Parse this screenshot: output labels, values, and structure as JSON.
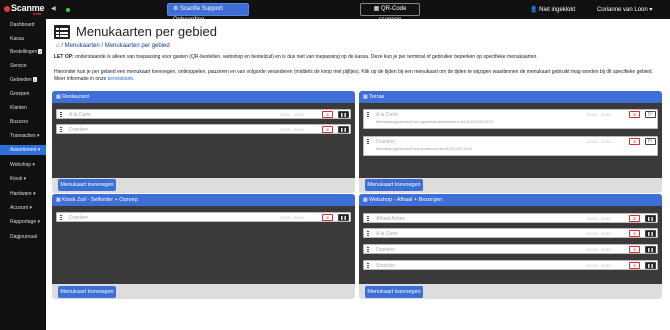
{
  "topbar": {
    "brand": "Scanme",
    "beta": "beta",
    "support_button": "Scanfie Support Onboarding",
    "qr_button": "QR-Code scannen",
    "login_status": "Niet ingeklokt",
    "user": "Corianne van Loon"
  },
  "sidebar": {
    "items": [
      {
        "label": "Dashboard"
      },
      {
        "label": "Kassa"
      },
      {
        "label": "Bestellingen",
        "badge": "2"
      },
      {
        "label": "Service"
      },
      {
        "label": "Gebieden",
        "badge": "1"
      },
      {
        "label": "Groepen"
      },
      {
        "label": "Klanten"
      },
      {
        "label": "Buzzers"
      },
      {
        "label": "Transacties"
      },
      {
        "label": "Assortiment"
      },
      {
        "label": "Webshop"
      },
      {
        "label": "Kiosk"
      },
      {
        "label": "Hardware"
      },
      {
        "label": "Account"
      },
      {
        "label": "Rapportage"
      },
      {
        "label": "Dagjournaal"
      }
    ]
  },
  "page": {
    "title": "Menukaarten per gebied",
    "breadcrumb": {
      "home": "⌂",
      "level1": "Menukaarten",
      "sep": "/",
      "level2": "Menukaarten per gebied"
    },
    "note1_bold": "LET OP:",
    "note1": " onderstaande is alleen van toepassing voor gasten (QR-bestellen, webshop en bestelzuil) en is dus niet van toepassing op de kassa. Deze kun je per terminal of gebruiker beperken op specifieke menukaarten.",
    "note2": "Hieronder kun je per gebied een menukaart toevoegen, ontkoppelen, pauzeren en van volgorde veranderen (middels de knop met pijltjes). Klik op de tijden bij een menukaart om de tijden te wijzigen waarbinnen de menukaart gebruikt mag worden bij dit specifieke gebied. Meer informatie in onze ",
    "note2_link": "kennisbank"
  },
  "add_label": "Menukaart toevoegen",
  "panels": [
    {
      "title": "Restaurant",
      "rows": [
        {
          "name": "A la Carte",
          "time": "00:00 - 23:59"
        },
        {
          "name": "Dranken",
          "time": "00:00 - 23:59"
        }
      ]
    },
    {
      "title": "Terras",
      "rows": [
        {
          "name": "A la Carte",
          "time": "00:00 - 23:59",
          "sub": "Menukaart gepauzeerd door gijsstafcta systeemtest.nl tot 06-03-2023 09:24"
        },
        {
          "name": "Dranken",
          "time": "00:00 - 23:59",
          "sub": "Menukaart gepauzeerd door testaccount tot 06-03-2023 16:21"
        }
      ]
    },
    {
      "title": "Kiosk Zuil - Selforder + Oproep",
      "rows": [
        {
          "name": "Dranken",
          "time": "00:00 - 23:59"
        }
      ]
    },
    {
      "title": "Webshop - Afhaal + Bezorgen",
      "rows": [
        {
          "name": "Afhaal Acties",
          "time": "00:00 - 23:59"
        },
        {
          "name": "A la Carte",
          "time": "00:00 - 23:59"
        },
        {
          "name": "Dranken",
          "time": "00:00 - 23:59"
        },
        {
          "name": "Snacktie",
          "time": "00:00 - 23:59"
        }
      ]
    }
  ]
}
